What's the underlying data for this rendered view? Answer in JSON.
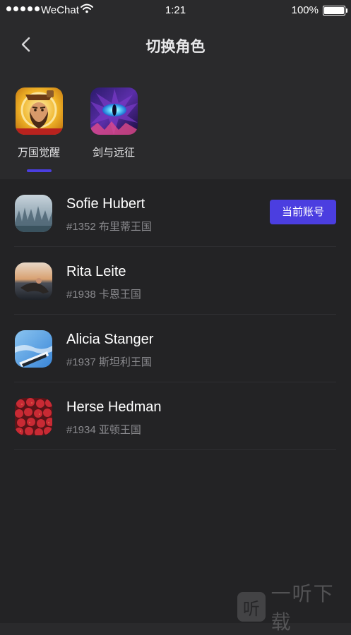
{
  "status_bar": {
    "carrier": "WeChat",
    "time": "1:21",
    "battery": "100%"
  },
  "header": {
    "title": "切换角色"
  },
  "games": [
    {
      "label": "万国觉醒",
      "icon": "rise-of-kingdoms-icon",
      "selected": true
    },
    {
      "label": "剑与远征",
      "icon": "afk-arena-dragon-icon",
      "selected": false
    }
  ],
  "accounts": [
    {
      "name": "Sofie Hubert",
      "meta": "#1352 布里蒂王国",
      "avatar": "misty-forest-photo",
      "current": true
    },
    {
      "name": "Rita Leite",
      "meta": "#1938 卡恩王国",
      "avatar": "beach-sunset-photo",
      "current": false
    },
    {
      "name": "Alicia Stanger",
      "meta": "#1937 斯坦利王国",
      "avatar": "sky-building-photo",
      "current": false
    },
    {
      "name": "Herse Hedman",
      "meta": "#1934 亚顿王国",
      "avatar": "strawberries-photo",
      "current": false
    }
  ],
  "current_account_label": "当前账号",
  "watermark": {
    "logo": "听",
    "text": "一听下载"
  },
  "colors": {
    "accent": "#4b3ee0",
    "background": "#2a2a2c",
    "list_background": "#232325",
    "secondary_text": "#8a8a8e"
  }
}
